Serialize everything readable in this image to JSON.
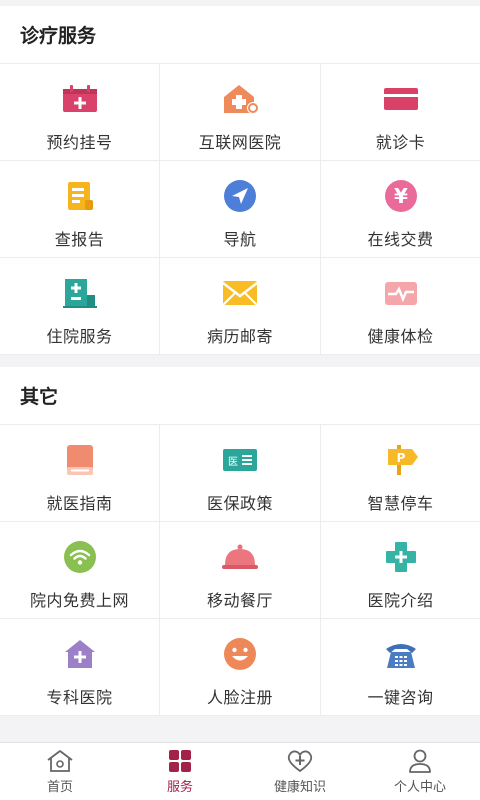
{
  "sections": [
    {
      "title": "诊疗服务",
      "items": [
        {
          "label": "预约挂号",
          "icon": "calendar-plus-icon"
        },
        {
          "label": "互联网医院",
          "icon": "hospital-house-icon"
        },
        {
          "label": "就诊卡",
          "icon": "card-icon"
        },
        {
          "label": "查报告",
          "icon": "report-icon"
        },
        {
          "label": "导航",
          "icon": "navigation-icon"
        },
        {
          "label": "在线交费",
          "icon": "yuan-payment-icon"
        },
        {
          "label": "住院服务",
          "icon": "inpatient-building-icon"
        },
        {
          "label": "病历邮寄",
          "icon": "envelope-icon"
        },
        {
          "label": "健康体检",
          "icon": "checkup-pulse-icon"
        }
      ]
    },
    {
      "title": "其它",
      "items": [
        {
          "label": "就医指南",
          "icon": "guide-book-icon"
        },
        {
          "label": "医保政策",
          "icon": "insurance-card-icon"
        },
        {
          "label": "智慧停车",
          "icon": "parking-sign-icon"
        },
        {
          "label": "院内免费上网",
          "icon": "wifi-icon"
        },
        {
          "label": "移动餐厅",
          "icon": "food-cloche-icon"
        },
        {
          "label": "医院介绍",
          "icon": "medical-cross-icon"
        },
        {
          "label": "专科医院",
          "icon": "specialty-hospital-icon"
        },
        {
          "label": "人脸注册",
          "icon": "face-icon"
        },
        {
          "label": "一键咨询",
          "icon": "telephone-icon"
        }
      ]
    }
  ],
  "tabbar": [
    {
      "label": "首页",
      "icon": "home-icon",
      "active": false
    },
    {
      "label": "服务",
      "icon": "grid-icon",
      "active": true
    },
    {
      "label": "健康知识",
      "icon": "heart-plus-icon",
      "active": false
    },
    {
      "label": "个人中心",
      "icon": "person-icon",
      "active": false
    }
  ],
  "colors": {
    "accent": "#a3224a"
  }
}
